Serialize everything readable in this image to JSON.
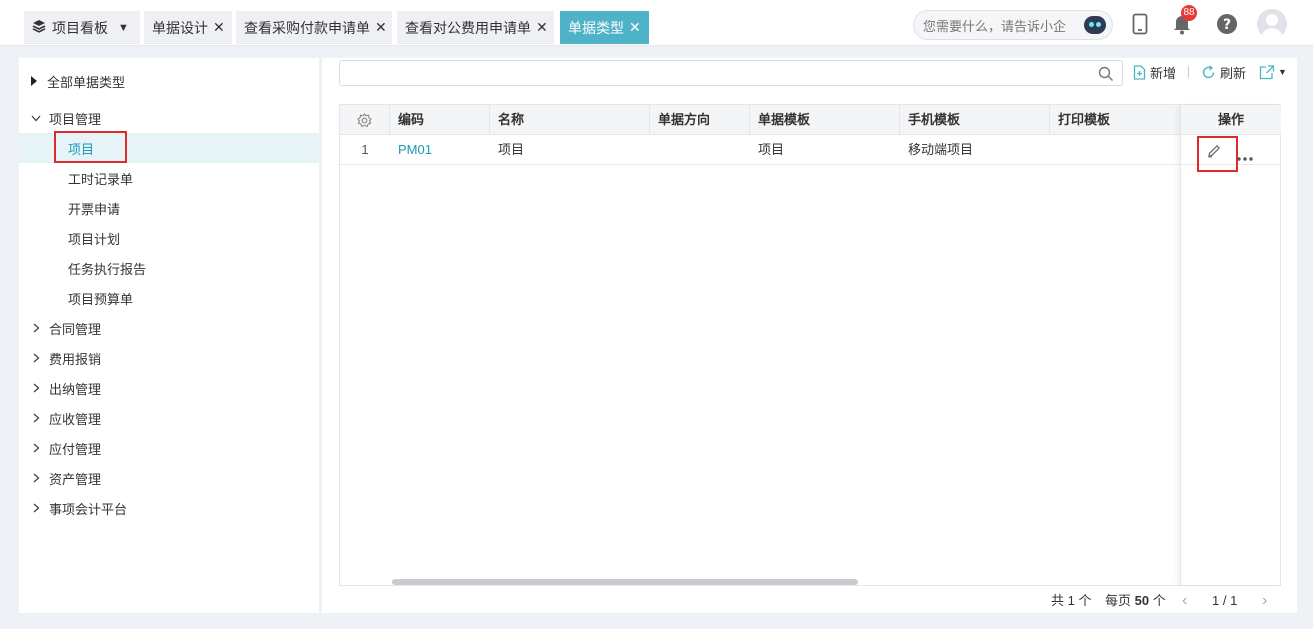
{
  "tabs": [
    {
      "label": "项目看板"
    },
    {
      "label": "单据设计"
    },
    {
      "label": "查看采购付款申请单"
    },
    {
      "label": "查看对公费用申请单"
    },
    {
      "label": "单据类型"
    }
  ],
  "header": {
    "search_placeholder": "您需要什么，请告诉小企",
    "notification_count": "88",
    "icons": [
      "mobile-icon",
      "bell-icon",
      "help-icon",
      "avatar"
    ]
  },
  "sidebar": {
    "root": "全部单据类型",
    "groups": [
      {
        "label": "项目管理",
        "expanded": true,
        "children": [
          "项目",
          "工时记录单",
          "开票申请",
          "项目计划",
          "任务执行报告",
          "项目预算单"
        ]
      },
      {
        "label": "合同管理"
      },
      {
        "label": "费用报销"
      },
      {
        "label": "出纳管理"
      },
      {
        "label": "应收管理"
      },
      {
        "label": "应付管理"
      },
      {
        "label": "资产管理"
      },
      {
        "label": "事项会计平台"
      }
    ],
    "selected": "项目"
  },
  "toolbar": {
    "add_label": "新增",
    "refresh_label": "刷新"
  },
  "table": {
    "columns": [
      "编码",
      "名称",
      "单据方向",
      "单据模板",
      "手机模板",
      "打印模板"
    ],
    "op_column": "操作",
    "rows": [
      {
        "index": "1",
        "code": "PM01",
        "name": "项目",
        "direction": "",
        "template": "项目",
        "mobile_template": "移动端项目",
        "print_template": ""
      }
    ]
  },
  "pager": {
    "total": "共 1 个",
    "per_page_prefix": "每页",
    "per_page": "50",
    "per_page_suffix": "个",
    "page": "1 / 1"
  },
  "colors": {
    "accent": "#4fb3c8",
    "link": "#1a9bb5",
    "highlight_box": "#e02a2a",
    "badge": "#e53935"
  }
}
